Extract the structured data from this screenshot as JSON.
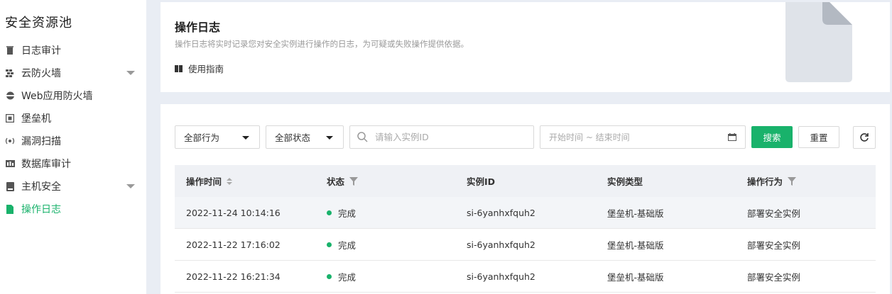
{
  "sidebar": {
    "title": "安全资源池",
    "items": [
      {
        "label": "日志审计",
        "icon": "log-audit-icon"
      },
      {
        "label": "云防火墙",
        "icon": "firewall-icon",
        "expandable": true
      },
      {
        "label": "Web应用防火墙",
        "icon": "web-firewall-icon"
      },
      {
        "label": "堡垒机",
        "icon": "bastion-icon"
      },
      {
        "label": "漏洞扫描",
        "icon": "scan-icon"
      },
      {
        "label": "数据库审计",
        "icon": "database-audit-icon"
      },
      {
        "label": "主机安全",
        "icon": "host-security-icon",
        "expandable": true
      },
      {
        "label": "操作日志",
        "icon": "document-icon",
        "active": true
      }
    ]
  },
  "info": {
    "title": "操作日志",
    "description": "操作日志将实时记录您对安全实例进行操作的日志，为可疑或失败操作提供依据。",
    "guide_label": "使用指南"
  },
  "filters": {
    "action_select": "全部行为",
    "status_select": "全部状态",
    "search_placeholder": "请输入实例ID",
    "date_range_placeholder": "开始时间 ~ 结束时间",
    "search_button": "搜索",
    "reset_button": "重置"
  },
  "table": {
    "columns": [
      "操作时间",
      "状态",
      "实例ID",
      "实例类型",
      "操作行为"
    ],
    "rows": [
      {
        "time": "2022-11-24 10:14:16",
        "status": "完成",
        "instance_id": "si-6yanhxfquh2",
        "type": "堡垒机-基础版",
        "action": "部署安全实例"
      },
      {
        "time": "2022-11-22 17:16:02",
        "status": "完成",
        "instance_id": "si-6yanhxfquh2",
        "type": "堡垒机-基础版",
        "action": "部署安全实例"
      },
      {
        "time": "2022-11-22 16:21:34",
        "status": "完成",
        "instance_id": "si-6yanhxfquh2",
        "type": "堡垒机-基础版",
        "action": "部署安全实例"
      }
    ]
  },
  "colors": {
    "accent": "#19b26b",
    "status_done": "#19b26b",
    "background": "#e9edf4"
  }
}
